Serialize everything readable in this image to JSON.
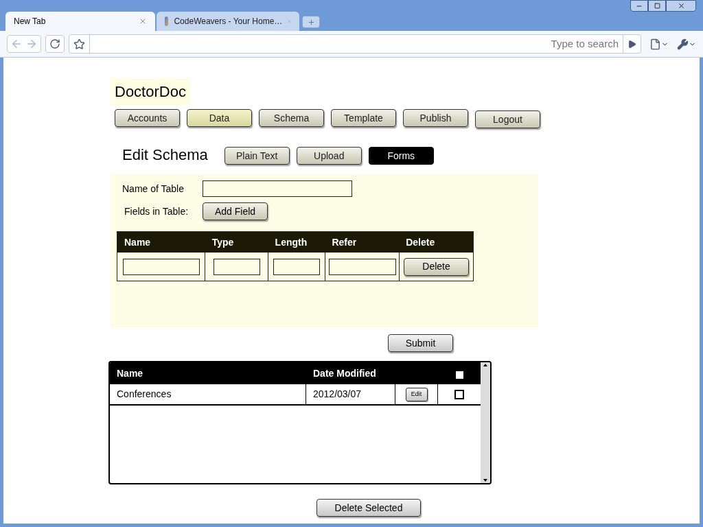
{
  "browser": {
    "tabs": [
      {
        "label": "New Tab",
        "selected": true
      },
      {
        "label": "CodeWeavers - Your Home…",
        "selected": false
      }
    ],
    "search_placeholder": "Type to search"
  },
  "app": {
    "title": "DoctorDoc",
    "nav": [
      {
        "label": "Accounts",
        "selected": false
      },
      {
        "label": "Data",
        "selected": true
      },
      {
        "label": "Schema",
        "selected": false
      },
      {
        "label": "Template",
        "selected": false
      },
      {
        "label": "Publish",
        "selected": false
      },
      {
        "label": "Logout",
        "selected": false
      }
    ],
    "heading": "Edit Schema",
    "modes": [
      {
        "label": "Plain Text",
        "selected": false
      },
      {
        "label": "Upload",
        "selected": false
      },
      {
        "label": "Forms",
        "selected": true
      }
    ],
    "form": {
      "name_label": "Name of Table",
      "fields_label": "Fields in Table:",
      "add_button": "Add Field",
      "columns": [
        "Name",
        "Type",
        "Length",
        "Refer",
        "Delete"
      ],
      "row_button": "Delete"
    },
    "submit": "Submit",
    "list": {
      "columns": [
        "Name",
        "Date Modified"
      ],
      "select_all_checked": false,
      "rows": [
        {
          "name": "Conferences",
          "date": "2012/03/07",
          "edit": "Edit",
          "checked": false
        }
      ]
    },
    "delete_selected": "Delete Selected"
  }
}
